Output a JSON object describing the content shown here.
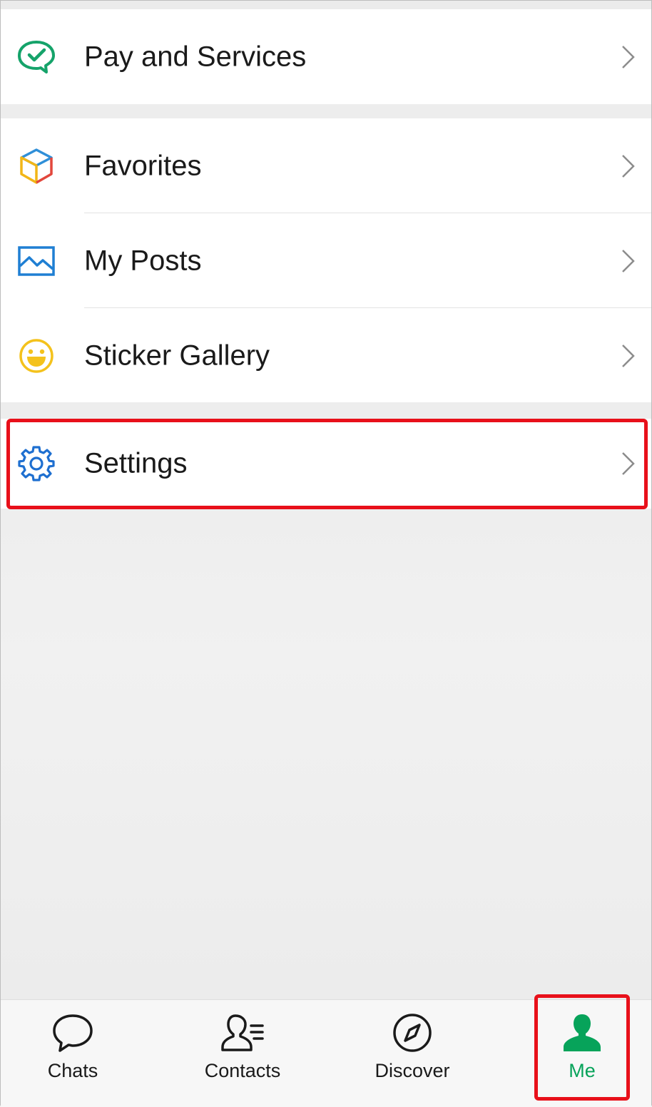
{
  "menu": {
    "pay_services": {
      "label": "Pay and Services",
      "icon": "pay-check-bubble-icon"
    },
    "favorites": {
      "label": "Favorites",
      "icon": "cube-icon"
    },
    "my_posts": {
      "label": "My Posts",
      "icon": "picture-icon"
    },
    "sticker_gallery": {
      "label": "Sticker Gallery",
      "icon": "smiley-icon"
    },
    "settings": {
      "label": "Settings",
      "icon": "gear-icon"
    }
  },
  "tabbar": {
    "tabs": [
      {
        "label": "Chats",
        "icon": "chat-bubble-icon",
        "active": false
      },
      {
        "label": "Contacts",
        "icon": "contacts-icon",
        "active": false
      },
      {
        "label": "Discover",
        "icon": "compass-icon",
        "active": false
      },
      {
        "label": "Me",
        "icon": "person-icon",
        "active": true
      }
    ]
  },
  "colors": {
    "accent_green": "#07a35a",
    "highlight_red": "#e8101a",
    "settings_blue": "#1e6fd0"
  }
}
